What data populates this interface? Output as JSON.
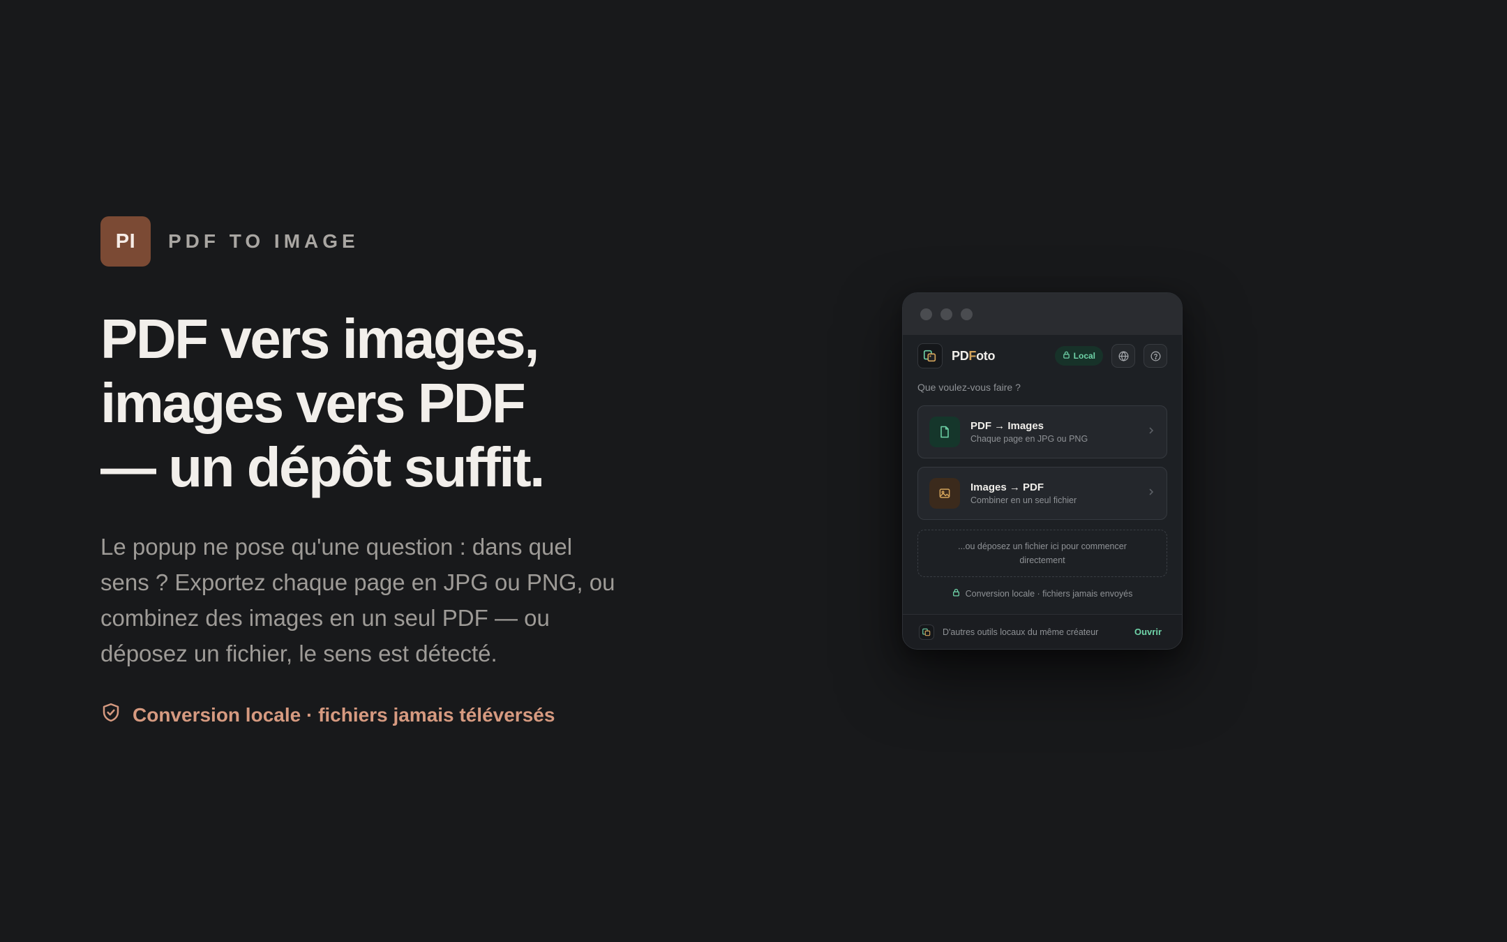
{
  "brand": {
    "badge": "PI",
    "name": "PDF TO IMAGE",
    "badge_color": "#7b4a34"
  },
  "hero": {
    "headline_lines": [
      "PDF vers images,",
      "images vers PDF",
      "— un dépôt suffit."
    ],
    "lead": "Le popup ne pose qu'une question : dans quel sens ? Exportez chaque page en JPG ou PNG, ou combinez des images en un seul PDF — ou déposez un fichier, le sens est détecté.",
    "privacy": "Conversion locale · fichiers jamais téléversés",
    "privacy_icon": "shield-check-icon",
    "privacy_color": "#d69a80"
  },
  "popup": {
    "app_name_prefix": "PD",
    "app_name_accent": "F",
    "app_name_suffix": "oto",
    "local_badge": "Local",
    "question": "Que voulez-vous faire ?",
    "options": [
      {
        "title": "PDF → Images",
        "subtitle": "Chaque page en JPG ou PNG",
        "icon": "file-icon"
      },
      {
        "title": "Images → PDF",
        "subtitle": "Combiner en un seul fichier",
        "icon": "image-icon"
      }
    ],
    "dropzone": "...ou déposez un fichier ici pour commencer directement",
    "privacy": "Conversion locale · fichiers jamais envoyés",
    "footer_text": "D'autres outils locaux du même créateur",
    "footer_action": "Ouvrir",
    "accent_green": "#6fd3a8",
    "accent_amber": "#d3a35a"
  }
}
